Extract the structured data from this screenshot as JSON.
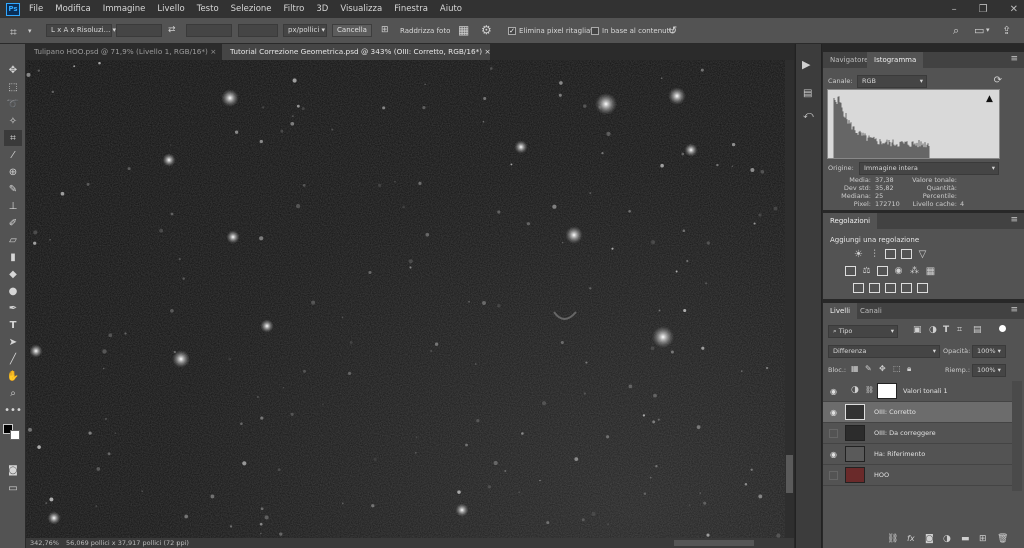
{
  "menu": {
    "items": [
      "File",
      "Modifica",
      "Immagine",
      "Livello",
      "Testo",
      "Selezione",
      "Filtro",
      "3D",
      "Visualizza",
      "Finestra",
      "Aiuto"
    ]
  },
  "options": {
    "ratio": "L x A x Risoluzi...",
    "units": "px/pollici",
    "cancel": "Cancella",
    "straighten": "Raddrizza foto",
    "delete_cropped": "Elimina pixel ritagliati",
    "content_aware": "In base al contenuto"
  },
  "tabs": [
    {
      "label": "Tulipano HOO.psd @ 71,9% (Livello 1, RGB/16*)",
      "active": false
    },
    {
      "label": "Tutorial Correzione Geometrica.psd @ 343% (OIII: Corretto, RGB/16*)",
      "active": true
    }
  ],
  "status": {
    "zoom": "342,76%",
    "doc_size": "56,069 pollici x 37,917 pollici (72 ppi)"
  },
  "histogram_panel": {
    "tabs": [
      "Navigatore",
      "Istogramma"
    ],
    "channel_label": "Canale:",
    "channel_value": "RGB",
    "source_label": "Origine:",
    "source_value": "Immagine intera",
    "stats_left": [
      {
        "label": "Media:",
        "value": "37,38"
      },
      {
        "label": "Dev std:",
        "value": "35,82"
      },
      {
        "label": "Mediana:",
        "value": "25"
      },
      {
        "label": "Pixel:",
        "value": "172710"
      }
    ],
    "stats_right": [
      {
        "label": "Valore tonale:",
        "value": ""
      },
      {
        "label": "Quantità:",
        "value": ""
      },
      {
        "label": "Percentile:",
        "value": ""
      },
      {
        "label": "Livello cache:",
        "value": "4"
      }
    ]
  },
  "adjustments_panel": {
    "tab": "Regolazioni",
    "hint": "Aggiungi una regolazione"
  },
  "layers_panel": {
    "tabs": [
      "Livelli",
      "Canali"
    ],
    "filter": "Tipo",
    "blend_mode": "Differenza",
    "opacity_label": "Opacità:",
    "opacity_value": "100%",
    "lock_label": "Bloc.:",
    "fill_label": "Riemp.:",
    "fill_value": "100%",
    "layers": [
      {
        "name": "Valori tonali 1",
        "visible": true,
        "selected": false
      },
      {
        "name": "OIII: Corretto",
        "visible": true,
        "selected": true
      },
      {
        "name": "OIII: Da correggere",
        "visible": false,
        "selected": false
      },
      {
        "name": "Ha: Riferimento",
        "visible": true,
        "selected": false
      },
      {
        "name": "HOO",
        "visible": false,
        "selected": false
      }
    ]
  },
  "colors": {
    "ps_blue": "#31a8ff",
    "panel_bg": "#535353",
    "selected_layer": "#6c6c6c"
  }
}
